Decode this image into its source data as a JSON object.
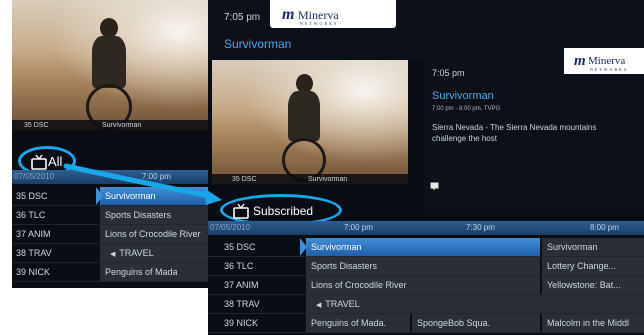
{
  "brand": {
    "logo_word": "Minerva",
    "logo_sub": "NETWORKS"
  },
  "screen1": {
    "caption": {
      "channel": "35 DSC",
      "title": "Survivorman"
    },
    "filter_label": "All",
    "date": "07/05/2010",
    "time_slot": "7:00 pm",
    "rows": [
      {
        "channel": "35 DSC",
        "program": "Survivorman"
      },
      {
        "channel": "36 TLC",
        "program": "Sports Disasters"
      },
      {
        "channel": "37 ANIM",
        "program": "Lions of Crocodile River"
      },
      {
        "channel": "38 TRAV",
        "program": "TRAVEL"
      },
      {
        "channel": "39 NICK",
        "program": "Penguins of Mada"
      }
    ]
  },
  "screen2": {
    "clock": "7:05 pm",
    "title": "Survivorman",
    "caption": {
      "channel": "35 DSC",
      "title": "Survivorman"
    },
    "filter_label": "Subscribed",
    "date": "07/05/2010",
    "time_slots": [
      "7:00 pm",
      "7:30 pm",
      "8:00 pm"
    ],
    "rows": [
      {
        "channel": "35 DSC",
        "programs": [
          "Survivorman",
          "Survivorman"
        ]
      },
      {
        "channel": "36 TLC",
        "programs": [
          "Sports Disasters",
          "Lottery Change..."
        ]
      },
      {
        "channel": "37 ANIM",
        "programs": [
          "Lions of Crocodile River",
          "Yellowstone: Bat..."
        ]
      },
      {
        "channel": "38 TRAV",
        "programs": [
          "TRAVEL"
        ]
      },
      {
        "channel": "39 NICK",
        "programs": [
          "Penguins of Mada.",
          "SpongeBob Squa.",
          "Malcolm in the Middl"
        ]
      }
    ]
  },
  "screen3": {
    "clock": "7:05 pm",
    "title": "Survivorman",
    "subtitle": "7:00 pm - 8:00 pm, TVPG",
    "description": "Sierra Nevada - The Sierra Nevada mountains challenge the host"
  },
  "colors": {
    "highlight": "#18a7e8",
    "selected_row": "#2f7fc9",
    "guide_bg": "#0a0d14"
  }
}
